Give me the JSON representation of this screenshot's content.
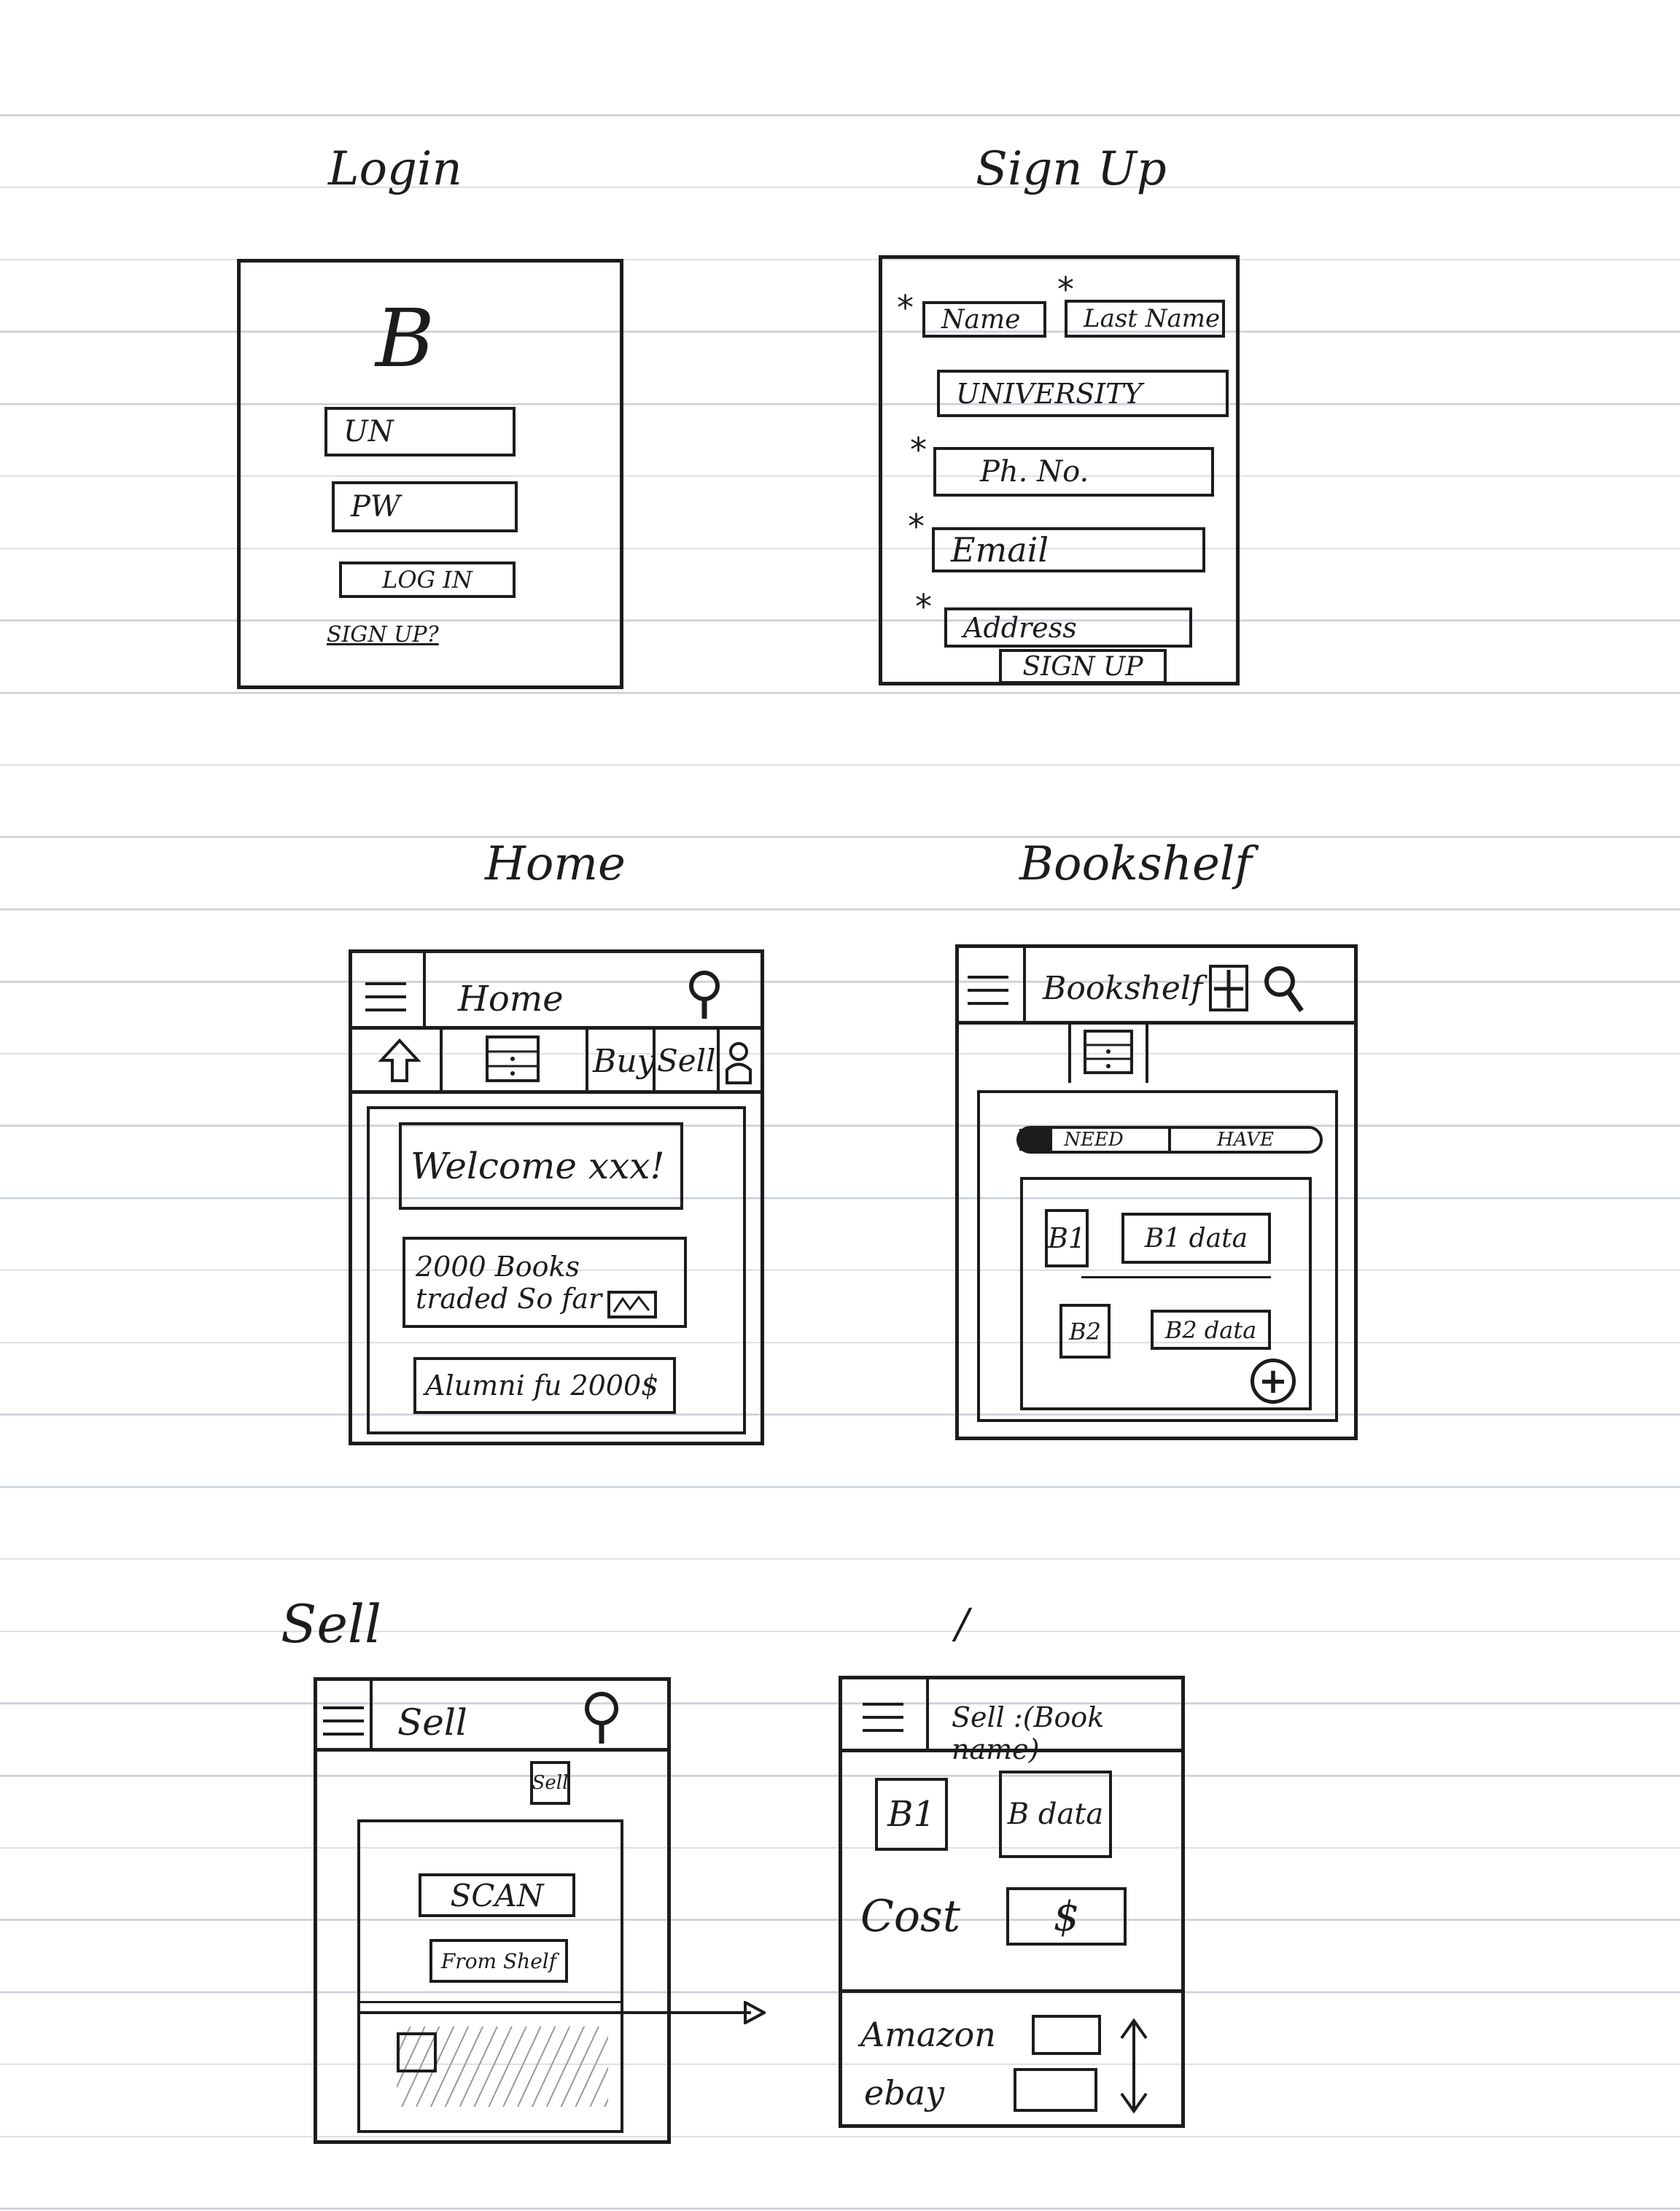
{
  "login": {
    "title": "Login",
    "logo": "B",
    "username_placeholder": "UN",
    "password_placeholder": "PW",
    "login_button": "LOG IN",
    "signup_link": "SIGN UP?"
  },
  "signup": {
    "title": "Sign Up",
    "required_mark": "*",
    "name": "Name",
    "last_name": "Last Name",
    "university": "UNIVERSITY",
    "phone": "Ph. No.",
    "email": "Email",
    "address": "Address",
    "signup_button": "SIGN UP"
  },
  "home": {
    "title": "Home",
    "header_title": "Home",
    "tabs": [
      "Buy",
      "Sell"
    ],
    "welcome": "Welcome xxx!",
    "books_traded": "2000 Books traded So far",
    "alumni": "Alumni fu 2000$"
  },
  "bookshelf": {
    "title": "Bookshelf",
    "header_title": "Bookshelf",
    "toggle_need": "NEED",
    "toggle_have": "HAVE",
    "items": [
      {
        "thumb": "B1",
        "data": "B1 data"
      },
      {
        "thumb": "B2",
        "data": "B2 data"
      }
    ],
    "add_symbol": "+"
  },
  "sell": {
    "title": "Sell",
    "header_title": "Sell",
    "tab_label": "Sell",
    "scan_button": "SCAN",
    "from_shelf_button": "From Shelf"
  },
  "sell_detail": {
    "title": "/",
    "header_title": "Sell :(Book name)",
    "thumb": "B1",
    "data": "B data",
    "cost_label": "Cost",
    "price_symbol": "$",
    "marketplaces": [
      "Amazon",
      "ebay"
    ]
  }
}
